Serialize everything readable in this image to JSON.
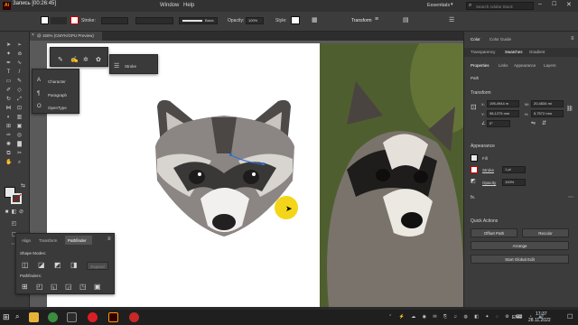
{
  "window": {
    "title": "Запись [00:26:45]",
    "menu_window": "Window",
    "menu_help": "Help"
  },
  "options_bar": {
    "stroke_label": "Stroke:",
    "brush_preset": "Basic",
    "opacity_label": "Opacity:",
    "opacity_value": "100%",
    "style_label": "Style:",
    "transform_label": "Transform",
    "workspace": "Essentials",
    "search_placeholder": "Search Adobe Stock"
  },
  "document_tab": {
    "label": "@ 150% (CMYK/GPU Preview)"
  },
  "stroke_panel": {
    "title": "Stroke"
  },
  "character_panel": {
    "items": [
      "Character",
      "Paragraph",
      "OpenType"
    ]
  },
  "pathfinder_panel": {
    "tabs": [
      "Align",
      "Transform",
      "Pathfinder"
    ],
    "shape_modes_label": "Shape Modes:",
    "expand_label": "Expand",
    "pathfinders_label": "Pathfinders:"
  },
  "right_panel": {
    "top_tabs": [
      "Color",
      "Color Guide"
    ],
    "swatch_tabs": [
      "Transparency",
      "Swatches",
      "Gradient"
    ],
    "prop_tabs": [
      "Properties",
      "Links",
      "Appearance",
      "Layers"
    ],
    "selection_type": "Path",
    "transform_title": "Transform",
    "x_label": "X:",
    "x_value": "195,4944 m",
    "y_label": "Y:",
    "y_value": "98,1275 mm",
    "w_label": "W:",
    "w_value": "20,4834 mi",
    "h_label": "H:",
    "h_value": "5,7572 mm",
    "angle_value": "0°",
    "appearance_title": "Appearance",
    "fill_label": "Fill",
    "stroke_label": "Stroke",
    "stroke_value": "1 pt",
    "opacity_label": "Opacity",
    "opacity_value": "100%",
    "fx_label": "fx.",
    "quick_actions_title": "Quick Actions",
    "offset_path": "Offset Path",
    "recolor": "Recolor",
    "arrange": "Arrange",
    "start_global_edit": "Start Global Edit"
  },
  "taskbar": {
    "language": "ENG",
    "time": "17:37",
    "date": "28.11.2022"
  },
  "colors": {
    "accent_yellow": "#f2d100",
    "illustrator_orange": "#ff9a00",
    "illustrator_bg": "#330000",
    "selection_blue": "#2f6fd6"
  }
}
